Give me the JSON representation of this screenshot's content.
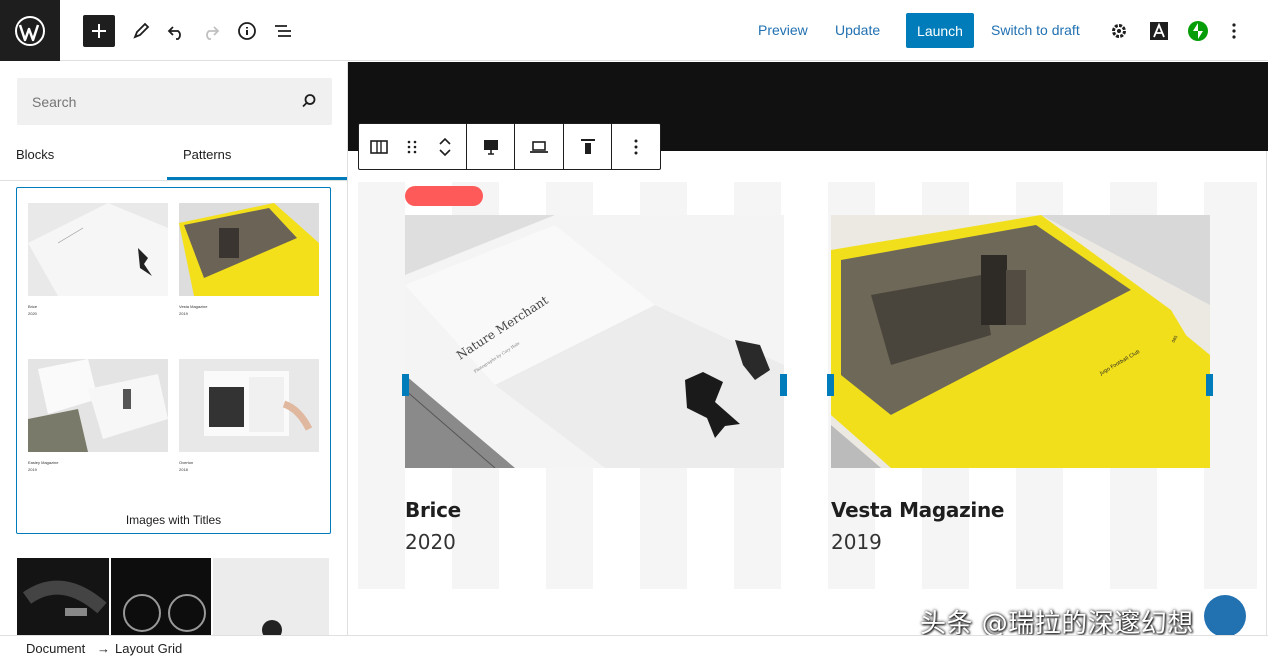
{
  "topbar": {
    "logo_icon": "wordpress-logo-icon",
    "tools": [
      "add-block-icon",
      "pencil-icon",
      "undo-icon",
      "redo-icon",
      "info-icon",
      "list-view-icon"
    ],
    "preview_label": "Preview",
    "update_label": "Update",
    "launch_label": "Launch",
    "switch_draft_label": "Switch to draft",
    "right_icons": [
      "gear-icon",
      "typography-icon",
      "jetpack-icon",
      "more-vertical-icon"
    ],
    "accent_color": "#007cba"
  },
  "sidebar": {
    "search": {
      "placeholder": "Search"
    },
    "tabs": [
      {
        "label": "Blocks",
        "active": false
      },
      {
        "label": "Patterns",
        "active": true
      }
    ],
    "pattern": {
      "name": "Images with Titles",
      "thumbs": [
        {
          "title": "Brice",
          "year": "2020"
        },
        {
          "title": "Vesta Magazine",
          "year": "2019"
        },
        {
          "title": "Easley Magazine",
          "year": "2019"
        },
        {
          "title": "Overton",
          "year": "2018"
        }
      ]
    }
  },
  "canvas": {
    "items": [
      {
        "title": "Brice",
        "year": "2020",
        "book_title": "Nature Merchant",
        "book_subtitle": "Photographs by Cory Hale"
      },
      {
        "title": "Vesta Magazine",
        "year": "2019",
        "book_label": "Jugo Football Club",
        "page_no": "085"
      }
    ],
    "pill_color": "#ff5a5a"
  },
  "watermark": "头条 @瑞拉的深邃幻想",
  "breadcrumb": {
    "root": "Document",
    "separator": "→",
    "current": "Layout Grid"
  }
}
